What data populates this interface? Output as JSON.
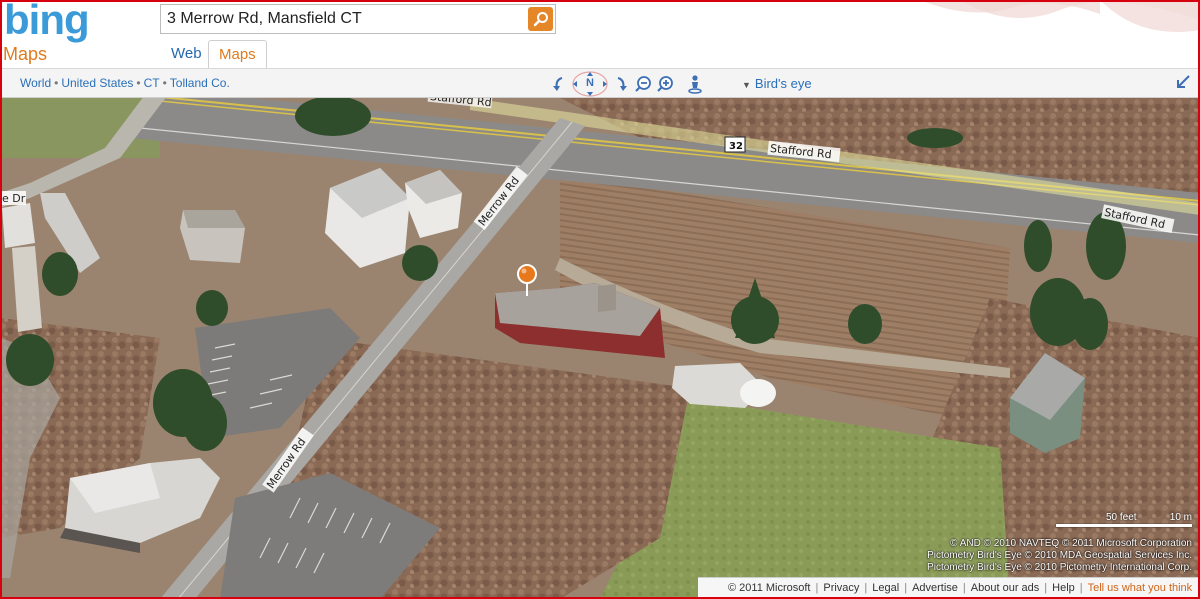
{
  "header": {
    "logo": "bing",
    "subtitle": "Maps",
    "search_value": "3 Merrow Rd, Mansfield CT",
    "tabs": {
      "web": "Web",
      "maps": "Maps"
    }
  },
  "toolbar": {
    "breadcrumb": [
      "World",
      "United States",
      "CT",
      "Tolland Co."
    ],
    "compass_label": "N",
    "view_mode": "Bird's eye"
  },
  "map": {
    "road_labels": {
      "top": "Stafford Rd",
      "stafford_1": "Stafford Rd",
      "stafford_2": "Stafford Rd",
      "merrow_1": "Merrow Rd",
      "merrow_2": "Merrow Rd",
      "left_edge": "e Dr"
    },
    "route_shield": "32",
    "scale": {
      "feet": "50 feet",
      "meters": "10 m"
    },
    "attribution": [
      "© AND   © 2010 NAVTEQ   © 2011 Microsoft Corporation",
      "Pictometry Bird's Eye © 2010 MDA Geospatial Services Inc.",
      "Pictometry Bird's Eye © 2010 Pictometry International Corp."
    ]
  },
  "footer": {
    "copyright": "© 2011 Microsoft",
    "links": [
      "Privacy",
      "Legal",
      "Advertise",
      "About our ads",
      "Help"
    ],
    "feedback": "Tell us what you think"
  },
  "colors": {
    "accent_orange": "#e07a1c",
    "link_blue": "#2a6fb8",
    "border_red": "#d6000f"
  }
}
